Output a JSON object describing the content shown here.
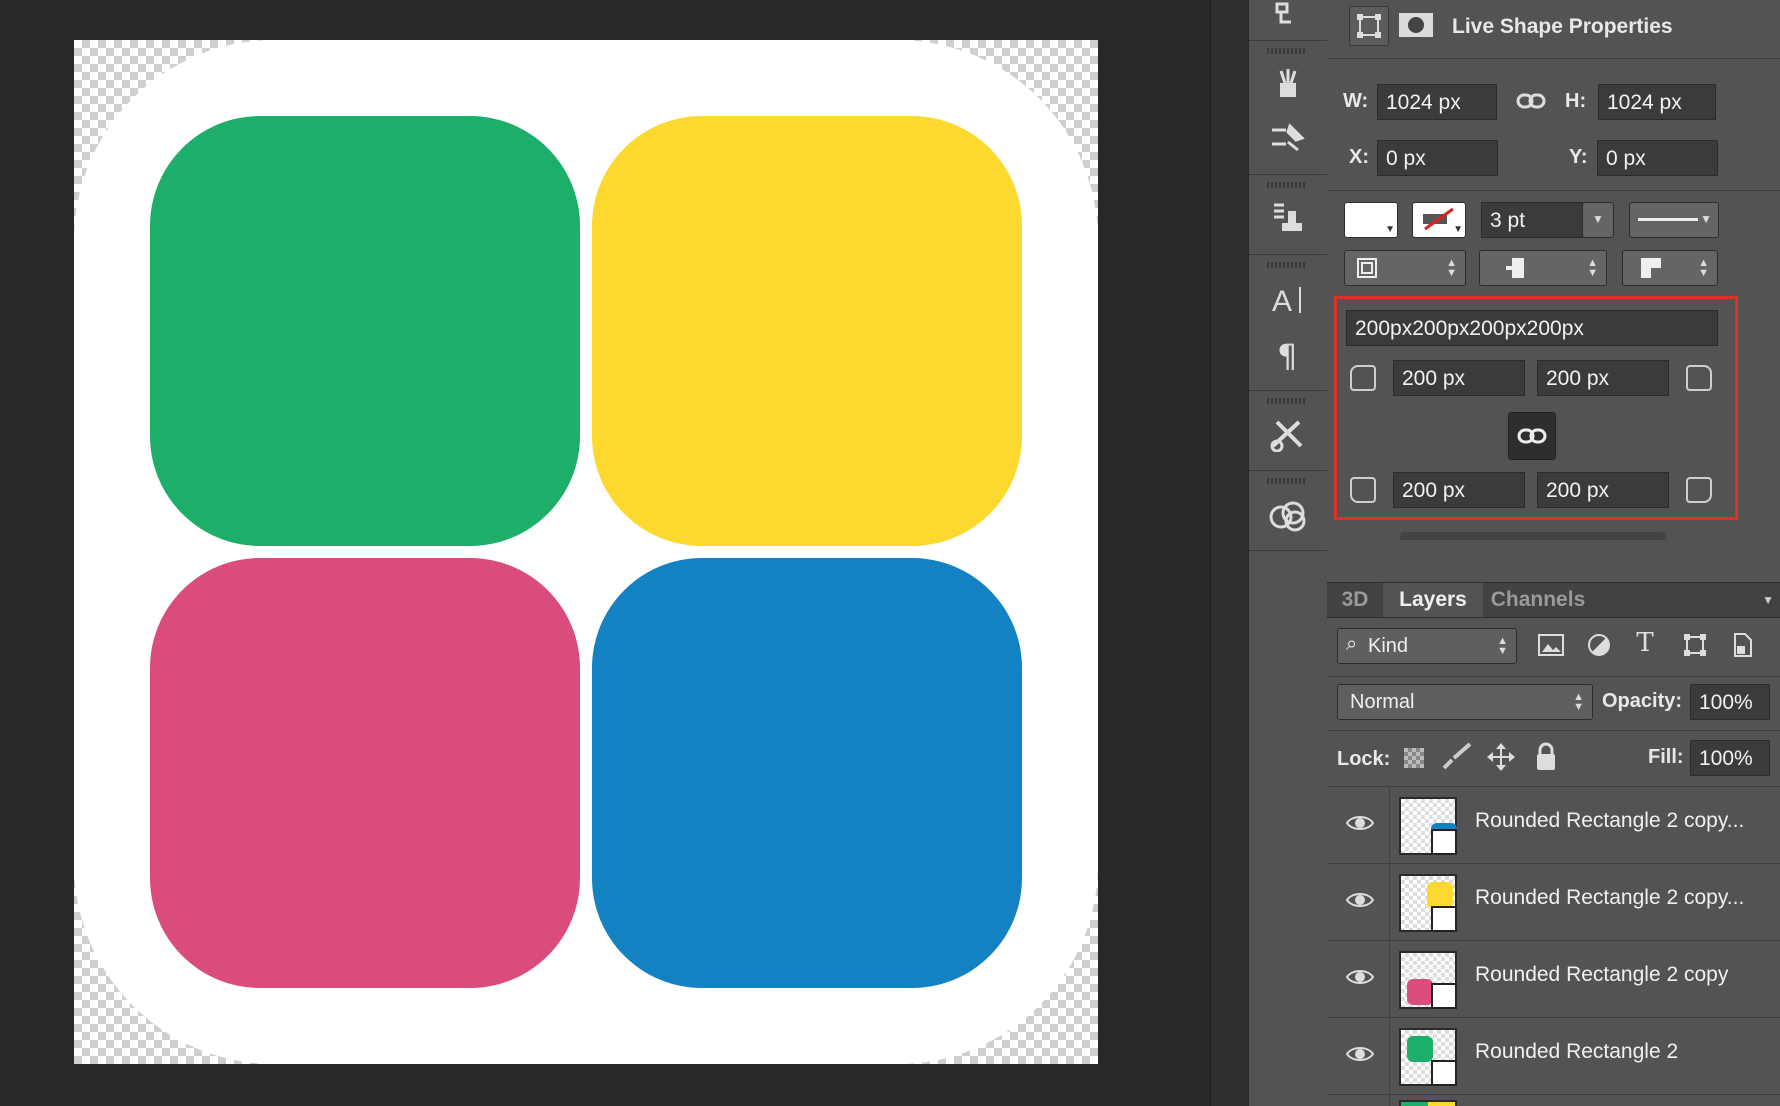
{
  "canvas": {
    "tiles": [
      {
        "name": "green-tile",
        "color": "#1dae6a"
      },
      {
        "name": "yellow-tile",
        "color": "#fdd92f"
      },
      {
        "name": "pink-tile",
        "color": "#da4c7e"
      },
      {
        "name": "blue-tile",
        "color": "#1282c3"
      }
    ]
  },
  "properties": {
    "title": "Live Shape Properties",
    "w_label": "W:",
    "w_value": "1024 px",
    "h_label": "H:",
    "h_value": "1024 px",
    "x_label": "X:",
    "x_value": "0 px",
    "y_label": "Y:",
    "y_value": "0 px",
    "stroke_width": "3 pt",
    "corner_radius_all": "200px200px200px200px",
    "corner_tl": "200 px",
    "corner_tr": "200 px",
    "corner_bl": "200 px",
    "corner_br": "200 px",
    "highlight_color": "#e0302a"
  },
  "layers_panel": {
    "tabs": [
      "3D",
      "Layers",
      "Channels"
    ],
    "active_tab": "Layers",
    "filter_kind": "Kind",
    "blend_mode": "Normal",
    "opacity_label": "Opacity:",
    "opacity_value": "100%",
    "lock_label": "Lock:",
    "fill_label": "Fill:",
    "fill_value": "100%",
    "layers": [
      {
        "name": "Rounded Rectangle 2 copy...",
        "color": "#1282c3"
      },
      {
        "name": "Rounded Rectangle 2 copy...",
        "color": "#fdd92f"
      },
      {
        "name": "Rounded Rectangle 2 copy",
        "color": "#da4c7e"
      },
      {
        "name": "Rounded Rectangle 2",
        "color": "#1dae6a"
      }
    ]
  }
}
